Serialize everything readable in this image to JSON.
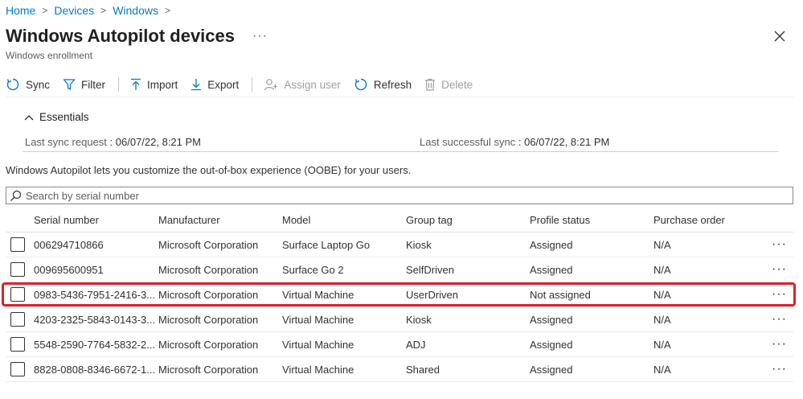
{
  "breadcrumb": {
    "items": [
      "Home",
      "Devices",
      "Windows"
    ],
    "separator": ">"
  },
  "header": {
    "title": "Windows Autopilot devices",
    "more": "···",
    "subtitle": "Windows enrollment"
  },
  "toolbar": {
    "sync": "Sync",
    "filter": "Filter",
    "import": "Import",
    "export": "Export",
    "assign_user": "Assign user",
    "refresh": "Refresh",
    "delete": "Delete"
  },
  "essentials": {
    "title": "Essentials",
    "last_sync_request_label": "Last sync request",
    "last_sync_request_value": "06/07/22, 8:21 PM",
    "last_successful_sync_label": "Last successful sync",
    "last_successful_sync_value": "06/07/22, 8:21 PM",
    "separator": ":"
  },
  "description": "Windows Autopilot lets you customize the out-of-box experience (OOBE) for your users.",
  "search": {
    "placeholder": "Search by serial number",
    "value": ""
  },
  "table": {
    "columns": [
      "Serial number",
      "Manufacturer",
      "Model",
      "Group tag",
      "Profile status",
      "Purchase order"
    ],
    "rows": [
      {
        "serial": "006294710866",
        "manufacturer": "Microsoft Corporation",
        "model": "Surface Laptop Go",
        "group_tag": "Kiosk",
        "profile_status": "Assigned",
        "purchase_order": "N/A"
      },
      {
        "serial": "009695600951",
        "manufacturer": "Microsoft Corporation",
        "model": "Surface Go 2",
        "group_tag": "SelfDriven",
        "profile_status": "Assigned",
        "purchase_order": "N/A"
      },
      {
        "serial": "0983-5436-7951-2416-3...",
        "manufacturer": "Microsoft Corporation",
        "model": "Virtual Machine",
        "group_tag": "UserDriven",
        "profile_status": "Not assigned",
        "purchase_order": "N/A"
      },
      {
        "serial": "4203-2325-5843-0143-3...",
        "manufacturer": "Microsoft Corporation",
        "model": "Virtual Machine",
        "group_tag": "Kiosk",
        "profile_status": "Assigned",
        "purchase_order": "N/A"
      },
      {
        "serial": "5548-2590-7764-5832-2...",
        "manufacturer": "Microsoft Corporation",
        "model": "Virtual Machine",
        "group_tag": "ADJ",
        "profile_status": "Assigned",
        "purchase_order": "N/A"
      },
      {
        "serial": "8828-0808-8346-6672-1...",
        "manufacturer": "Microsoft Corporation",
        "model": "Virtual Machine",
        "group_tag": "Shared",
        "profile_status": "Assigned",
        "purchase_order": "N/A"
      }
    ],
    "row_more": "···"
  },
  "colors": {
    "accent": "#0078d4",
    "highlight": "#d9232e",
    "disabled": "#a19f9d"
  }
}
